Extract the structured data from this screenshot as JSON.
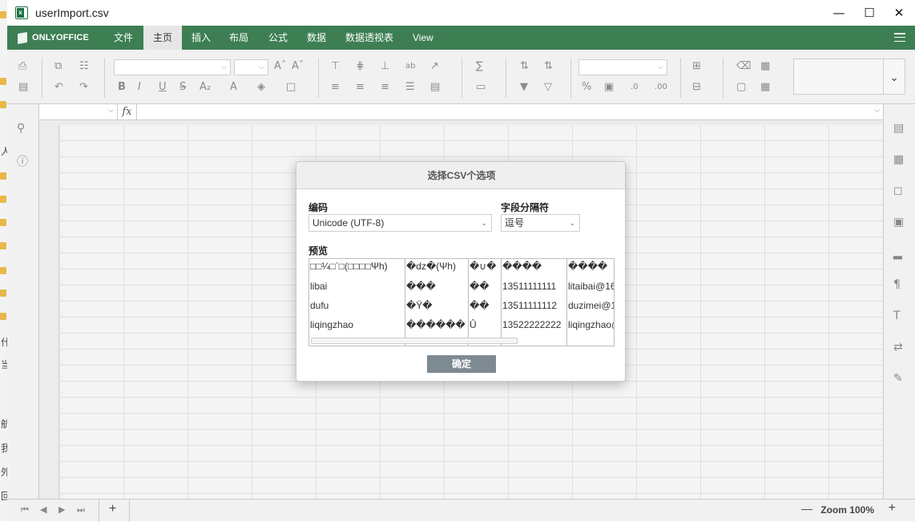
{
  "window": {
    "title": "userImport.csv",
    "minimize_icon": "minimize-icon",
    "maximize_icon": "maximize-icon",
    "close_icon": "close-icon"
  },
  "menubar": {
    "logo": "ONLYOFFICE",
    "tabs": [
      "文件",
      "主页",
      "插入",
      "布局",
      "公式",
      "数据",
      "数据透视表",
      "View"
    ],
    "active_tab": "主页",
    "accent_color": "#3d7f53"
  },
  "desktop_strip": {
    "glyphs": [
      "人",
      "什",
      "当",
      "航",
      "我",
      "外",
      "回"
    ]
  },
  "toolbar": {
    "font_name": "",
    "font_size": "",
    "number_format": ""
  },
  "formula": {
    "cell_ref": "",
    "fx_label": "fx",
    "value": ""
  },
  "status": {
    "zoom": "Zoom 100%",
    "minus": "—",
    "plus": "+",
    "add_sheet": "+"
  },
  "dialog": {
    "title": "选择CSV个选项",
    "encoding_label": "编码",
    "encoding_value": "Unicode (UTF-8)",
    "delimiter_label": "字段分隔符",
    "delimiter_value": "逗号",
    "preview_label": "预览",
    "preview_columns": [
      [
        "□□¼□`□(□□□□Ψh)",
        "libai",
        "dufu",
        "liqingzhao"
      ],
      [
        "�dz�(Ψh)",
        "���",
        "�Ÿ�",
        "������"
      ],
      [
        "�∪�",
        "��",
        "��",
        "Û"
      ],
      [
        "����",
        "13511111111",
        "13511111112",
        "13522222222"
      ],
      [
        "����",
        "litaibai@16",
        "duzimei@1",
        "liqingzhao@"
      ]
    ],
    "ok_label": "确定"
  }
}
